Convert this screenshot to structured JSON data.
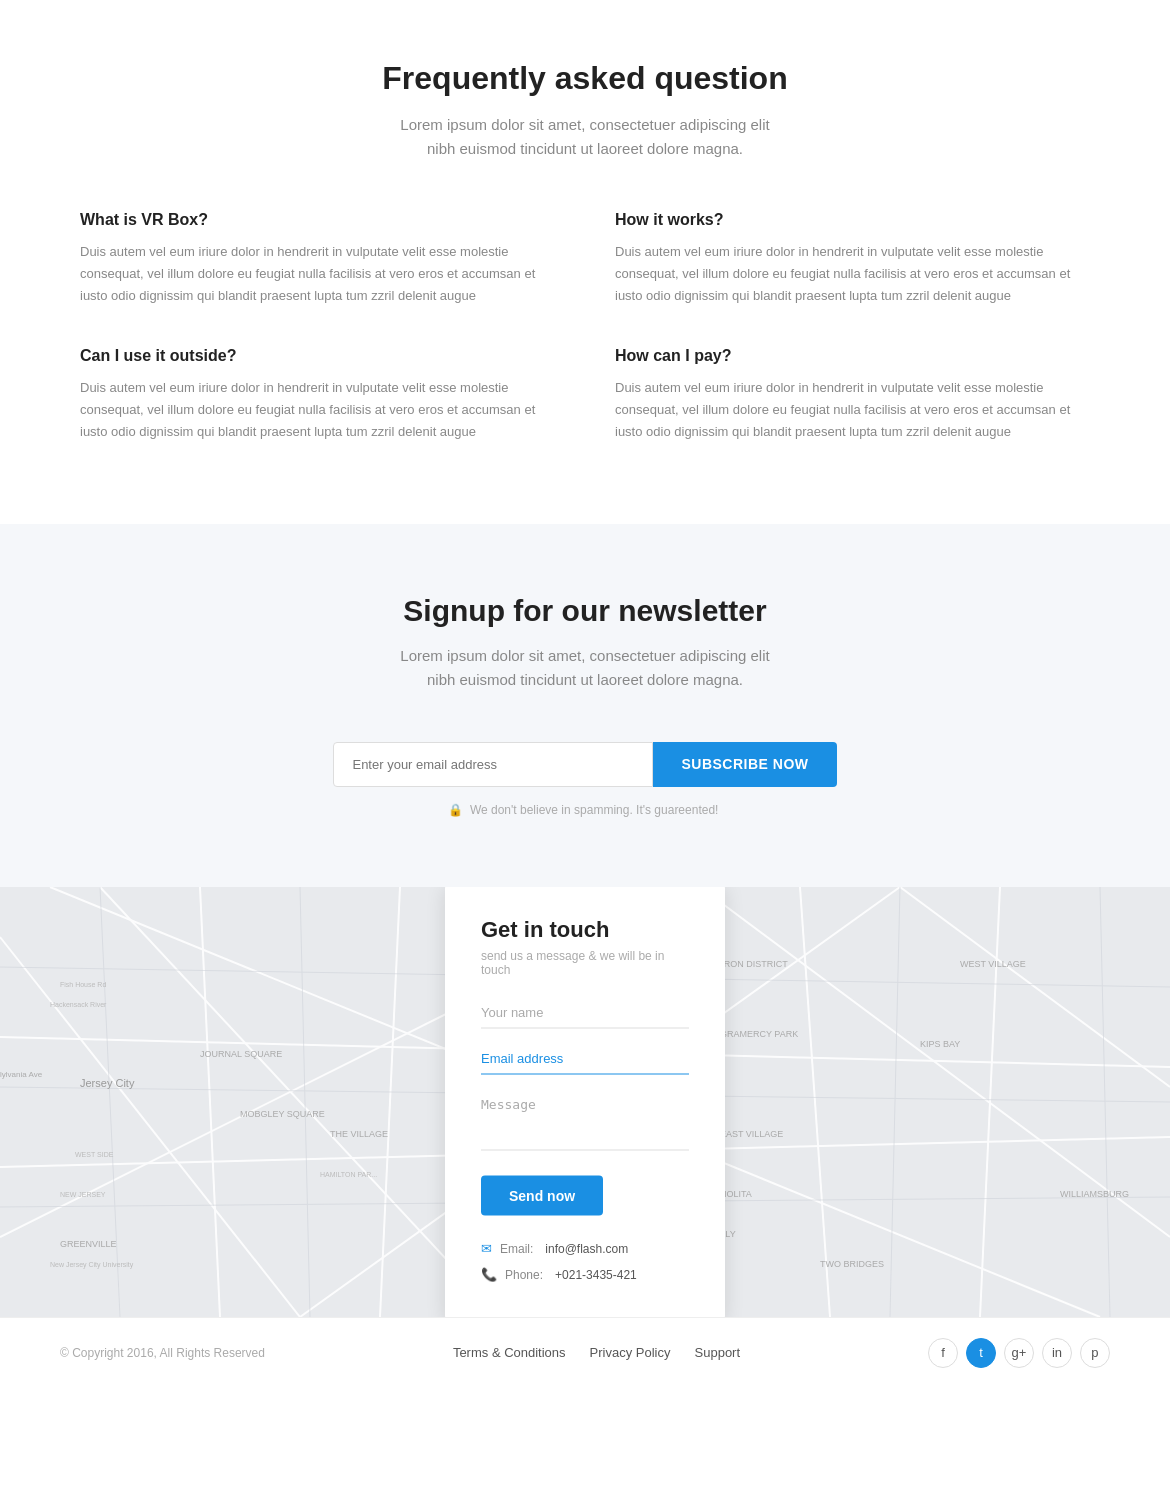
{
  "faq": {
    "title": "Frequently asked question",
    "subtitle": "Lorem ipsum dolor sit amet, consectetuer adipiscing elit\nnibh euismod tincidunt ut laoreet dolore magna.",
    "items": [
      {
        "question": "What is VR Box?",
        "answer": "Duis autem vel eum iriure dolor in hendrerit in vulputate velit esse molestie consequat, vel illum dolore eu feugiat nulla facilisis at vero eros et accumsan et iusto odio dignissim qui blandit praesent lupta tum zzril delenit augue"
      },
      {
        "question": "How it works?",
        "answer": "Duis autem vel eum iriure dolor in hendrerit in vulputate velit esse molestie consequat, vel illum dolore eu feugiat nulla facilisis at vero eros et accumsan et iusto odio dignissim qui blandit praesent lupta tum zzril delenit augue"
      },
      {
        "question": "Can I use it outside?",
        "answer": "Duis autem vel eum iriure dolor in hendrerit in vulputate velit esse molestie consequat, vel illum dolore eu feugiat nulla facilisis at vero eros et accumsan et iusto odio dignissim qui blandit praesent lupta tum zzril delenit augue"
      },
      {
        "question": "How can I pay?",
        "answer": "Duis autem vel eum iriure dolor in hendrerit in vulputate velit esse molestie consequat, vel illum dolore eu feugiat nulla facilisis at vero eros et accumsan et iusto odio dignissim qui blandit praesent lupta tum zzril delenit augue"
      }
    ]
  },
  "newsletter": {
    "title": "Signup for our newsletter",
    "subtitle": "Lorem ipsum dolor sit amet, consectetuer adipiscing elit\nnibh euismod tincidunt ut laoreet dolore magna.",
    "input_placeholder": "Enter your email address",
    "button_label": "Subscribe now",
    "spam_note": "We don't believe in spamming. It's guareented!"
  },
  "contact": {
    "title": "Get in touch",
    "tagline": "send us a message & we will be in touch",
    "name_placeholder": "Your name",
    "email_placeholder": "Email address",
    "email_value": "Email address",
    "message_placeholder": "Message",
    "button_label": "Send now",
    "email_label": "Email:",
    "email_value_display": "info@flash.com",
    "phone_label": "Phone:",
    "phone_value": "+021-3435-421"
  },
  "footer": {
    "copyright": "© Copyright 2016, All Rights Reserved",
    "links": [
      {
        "label": "Terms & Conditions",
        "url": "#"
      },
      {
        "label": "Privacy Policy",
        "url": "#"
      },
      {
        "label": "Support",
        "url": "#"
      }
    ],
    "social": [
      {
        "name": "facebook",
        "symbol": "f"
      },
      {
        "name": "twitter",
        "symbol": "t"
      },
      {
        "name": "google-plus",
        "symbol": "g+"
      },
      {
        "name": "linkedin",
        "symbol": "in"
      },
      {
        "name": "pinterest",
        "symbol": "p"
      }
    ]
  }
}
